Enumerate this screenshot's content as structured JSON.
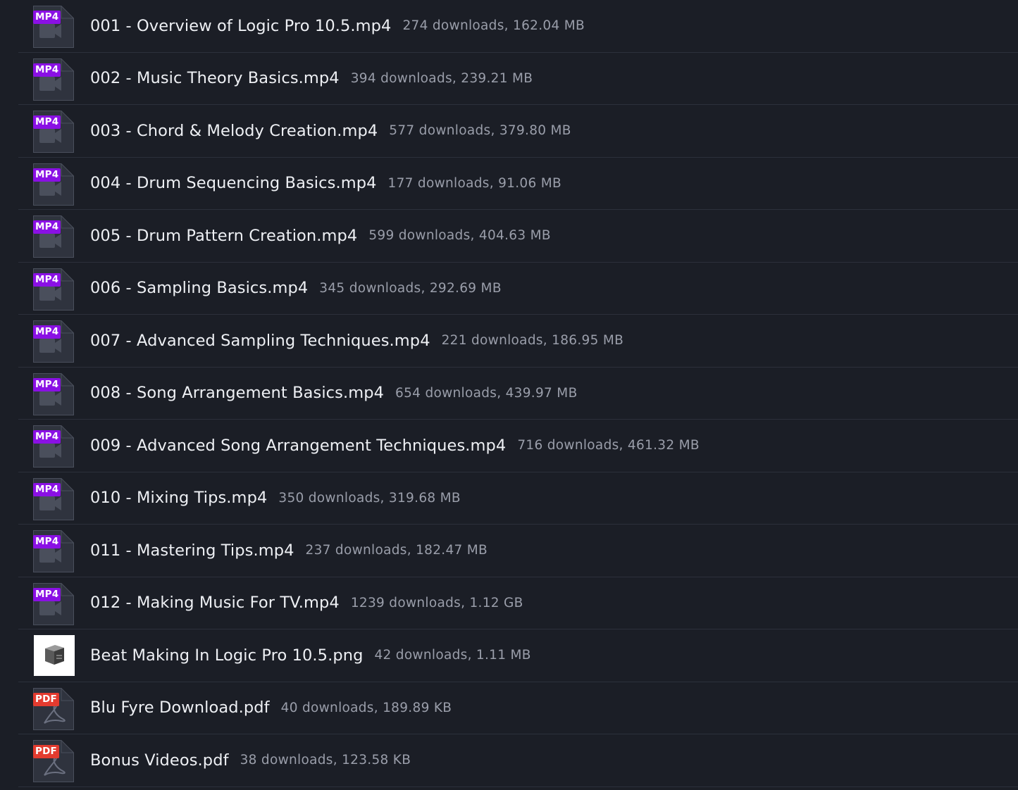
{
  "colors": {
    "background": "#1b1e26",
    "divider": "#2c303b",
    "mp4_badge": "#8a10e4",
    "pdf_badge": "#e33b2f",
    "icon_fill": "#2f333e",
    "filename_text": "#eef0f4",
    "meta_text": "#9a9eaa"
  },
  "files": [
    {
      "name": "001 - Overview of Logic Pro 10.5.mp4",
      "meta": "274 downloads, 162.04 MB",
      "type": "mp4",
      "badge": "MP4",
      "icon": "video-file-icon"
    },
    {
      "name": "002 - Music Theory Basics.mp4",
      "meta": "394 downloads, 239.21 MB",
      "type": "mp4",
      "badge": "MP4",
      "icon": "video-file-icon"
    },
    {
      "name": "003 - Chord & Melody Creation.mp4",
      "meta": "577 downloads, 379.80 MB",
      "type": "mp4",
      "badge": "MP4",
      "icon": "video-file-icon"
    },
    {
      "name": "004 - Drum Sequencing Basics.mp4",
      "meta": "177 downloads, 91.06 MB",
      "type": "mp4",
      "badge": "MP4",
      "icon": "video-file-icon"
    },
    {
      "name": "005 - Drum Pattern Creation.mp4",
      "meta": "599 downloads, 404.63 MB",
      "type": "mp4",
      "badge": "MP4",
      "icon": "video-file-icon"
    },
    {
      "name": "006 - Sampling Basics.mp4",
      "meta": "345 downloads, 292.69 MB",
      "type": "mp4",
      "badge": "MP4",
      "icon": "video-file-icon"
    },
    {
      "name": "007 - Advanced Sampling Techniques.mp4",
      "meta": "221 downloads, 186.95 MB",
      "type": "mp4",
      "badge": "MP4",
      "icon": "video-file-icon"
    },
    {
      "name": "008 - Song Arrangement Basics.mp4",
      "meta": "654 downloads, 439.97 MB",
      "type": "mp4",
      "badge": "MP4",
      "icon": "video-file-icon"
    },
    {
      "name": "009 - Advanced Song Arrangement Techniques.mp4",
      "meta": "716 downloads, 461.32 MB",
      "type": "mp4",
      "badge": "MP4",
      "icon": "video-file-icon"
    },
    {
      "name": "010 - Mixing Tips.mp4",
      "meta": "350 downloads, 319.68 MB",
      "type": "mp4",
      "badge": "MP4",
      "icon": "video-file-icon"
    },
    {
      "name": "011 - Mastering Tips.mp4",
      "meta": "237 downloads, 182.47 MB",
      "type": "mp4",
      "badge": "MP4",
      "icon": "video-file-icon"
    },
    {
      "name": "012 - Making Music For TV.mp4",
      "meta": "1239 downloads, 1.12 GB",
      "type": "mp4",
      "badge": "MP4",
      "icon": "video-file-icon"
    },
    {
      "name": "Beat Making In Logic Pro 10.5.png",
      "meta": "42 downloads, 1.11 MB",
      "type": "png",
      "badge": "",
      "icon": "image-thumbnail-icon"
    },
    {
      "name": "Blu Fyre Download.pdf",
      "meta": "40 downloads, 189.89 KB",
      "type": "pdf",
      "badge": "PDF",
      "icon": "pdf-file-icon"
    },
    {
      "name": "Bonus Videos.pdf",
      "meta": "38 downloads, 123.58 KB",
      "type": "pdf",
      "badge": "PDF",
      "icon": "pdf-file-icon"
    }
  ]
}
